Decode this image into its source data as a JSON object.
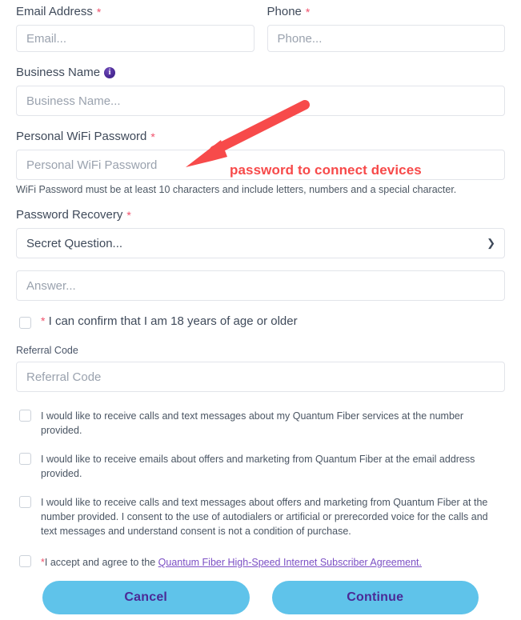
{
  "form": {
    "fields": {
      "email": {
        "label": "Email Address",
        "required_mark": "*",
        "placeholder": "Email..."
      },
      "phone": {
        "label": "Phone",
        "required_mark": "*",
        "placeholder": "Phone..."
      },
      "business_name": {
        "label": "Business Name",
        "info_icon": "info-icon",
        "placeholder": "Business Name..."
      },
      "wifi_password": {
        "label": "Personal WiFi Password",
        "required_mark": "*",
        "placeholder": "Personal WiFi Password",
        "helper": "WiFi Password must be at least 10 characters and include letters, numbers and a special character."
      },
      "password_recovery": {
        "label": "Password Recovery",
        "required_mark": "*",
        "selected_option": "Secret Question...",
        "chevron_icon": "chevron-down-icon",
        "options": [
          "Secret Question..."
        ],
        "answer_placeholder": "Answer..."
      },
      "referral_code": {
        "label": "Referral Code",
        "placeholder": "Referral Code"
      }
    },
    "age_confirm": {
      "required_mark": "*",
      "text": "I can confirm that I am 18 years of age or older"
    },
    "consents": [
      {
        "text": "I would like to receive calls and text messages about my Quantum Fiber services at the number provided."
      },
      {
        "text": "I would like to receive emails about offers and marketing from Quantum Fiber at the email address provided."
      },
      {
        "text": "I would like to receive calls and text messages about offers and marketing from Quantum Fiber at the number provided. I consent to the use of autodialers or artificial or prerecorded voice for the calls and text messages and understand consent is not a condition of purchase."
      }
    ],
    "agreement": {
      "required_mark": "*",
      "prefix": "I accept and agree to the ",
      "link_text": "Quantum Fiber High-Speed Internet Subscriber Agreement."
    },
    "buttons": {
      "cancel": "Cancel",
      "continue": "Continue"
    }
  },
  "annotation": {
    "text": "password to connect devices",
    "arrow_icon": "red-arrow-icon",
    "color": "#f74a4a"
  },
  "colors": {
    "required_asterisk": "#f0506b",
    "button_bg": "#5fc3ea",
    "button_text": "#4b2a96",
    "link": "#7b4fc4",
    "annotation": "#f74a4a",
    "info_icon": "#4b2a96"
  }
}
